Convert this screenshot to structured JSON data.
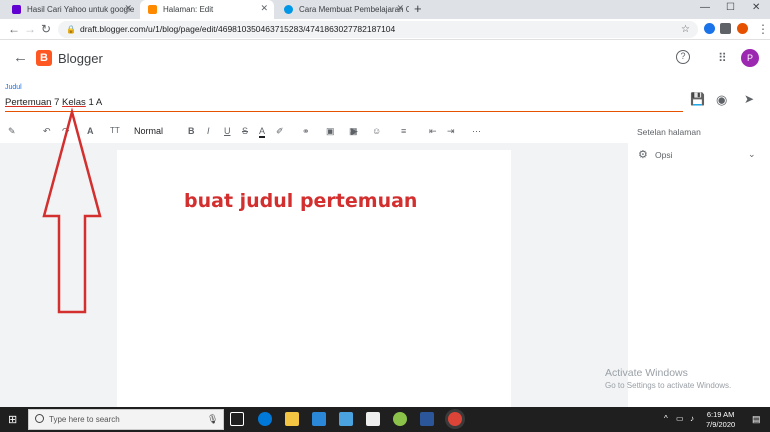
{
  "tabs": [
    {
      "title": "Hasil Cari Yahoo untuk google",
      "favicon_color": "#6001d2"
    },
    {
      "title": "Halaman: Edit",
      "favicon_color": "#ff8a00"
    },
    {
      "title": "Cara Membuat Pembelajaran Onl",
      "favicon_color": "#0097e6"
    }
  ],
  "tab_close": "✕",
  "new_tab": "+",
  "window_controls": {
    "minimize": "—",
    "maximize": "☐",
    "close": "✕"
  },
  "nav": {
    "back": "←",
    "forward": "→",
    "reload": "↻"
  },
  "url": "draft.blogger.com/u/1/blog/page/edit/4698103504637152​83/4741863027782187104",
  "app": {
    "back_icon": "←",
    "name": "Blogger",
    "logo_letter": "B",
    "avatar_letter": "P",
    "help": "?",
    "apps_icon": "⋮⋮⋮"
  },
  "title_field": {
    "label": "Judul",
    "value_parts": [
      "Pertemuan",
      " 7 ",
      "Kelas",
      " 1 A"
    ]
  },
  "toolbar": {
    "style_select": "Normal",
    "items": [
      "✎",
      "↶",
      "↷",
      "A",
      "TT",
      "B",
      "I",
      "U",
      "S",
      "A",
      "✐",
      "⚭",
      "▣",
      "▶",
      "▦",
      "☺",
      "≡",
      "⇤",
      "⇥",
      "⋯"
    ]
  },
  "annotation": "buat judul pertemuan",
  "side_panel": {
    "title": "Setelan halaman",
    "options_label": "Opsi"
  },
  "watermark": {
    "line1": "Activate Windows",
    "line2": "Go to Settings to activate Windows."
  },
  "taskbar": {
    "search_placeholder": "Type here to search",
    "time": "6:19 AM",
    "date": "7/9/2020"
  }
}
